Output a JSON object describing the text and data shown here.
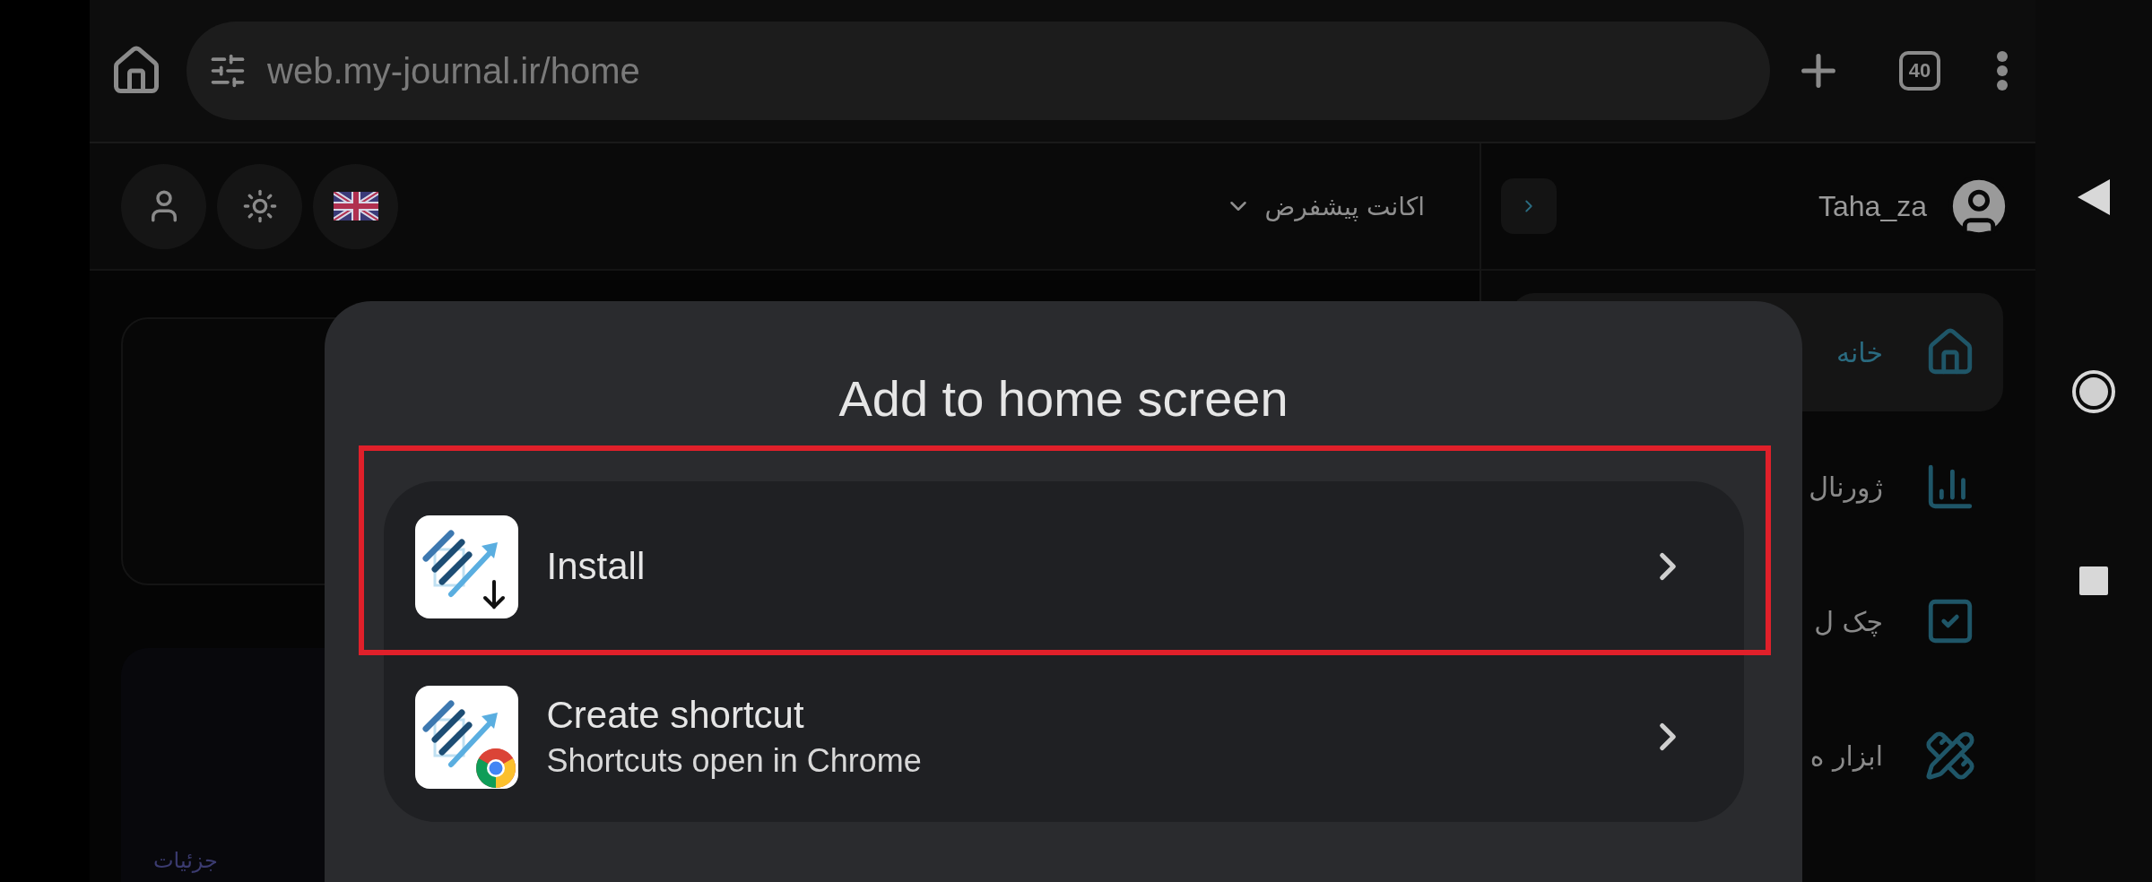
{
  "browser": {
    "url": "web.my-journal.ir/home",
    "tab_count": "40"
  },
  "header": {
    "account_menu": "اکانت پیشفرض"
  },
  "sidebar": {
    "user": "Taha_za",
    "items": [
      {
        "kind": "home",
        "label": "خانه",
        "selected": true
      },
      {
        "kind": "chart",
        "label": "ژورنال",
        "selected": false
      },
      {
        "kind": "check",
        "label": "چک ل",
        "selected": false
      },
      {
        "kind": "tools",
        "label": "ابزار ه",
        "selected": false
      }
    ]
  },
  "content": {
    "details_link": "جزئیات"
  },
  "dialog": {
    "title": "Add to home screen",
    "options": [
      {
        "kind": "install",
        "title": "Install",
        "highlighted": true
      },
      {
        "kind": "shortcut",
        "title": "Create shortcut",
        "subtitle": "Shortcuts open in Chrome",
        "highlighted": false
      }
    ]
  }
}
